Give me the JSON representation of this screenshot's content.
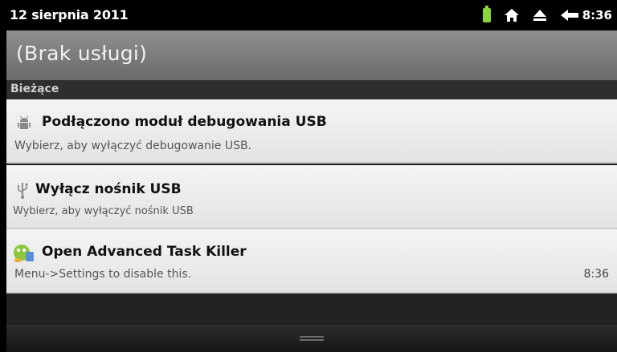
{
  "status_bar": {
    "date": "12 sierpnia 2011",
    "time": "8:36",
    "icons": [
      "battery-icon",
      "home-icon",
      "eject-icon",
      "back-arrow-icon"
    ],
    "battery_color": "#8ad53c"
  },
  "carrier": {
    "text": "(Brak usługi)"
  },
  "section": {
    "label": "Bieżące"
  },
  "notifications": [
    {
      "icon": "android-debug-icon",
      "title": "Podłączono moduł debugowania USB",
      "text": "Wybierz, aby wyłączyć debugowanie USB.",
      "time": ""
    },
    {
      "icon": "usb-icon",
      "title": "Wyłącz nośnik USB",
      "text": "Wybierz, aby wyłączyć nośnik USB",
      "time": ""
    },
    {
      "icon": "task-killer-icon",
      "title": "Open Advanced Task Killer",
      "text": "Menu->Settings to disable this.",
      "time": "8:36"
    }
  ]
}
